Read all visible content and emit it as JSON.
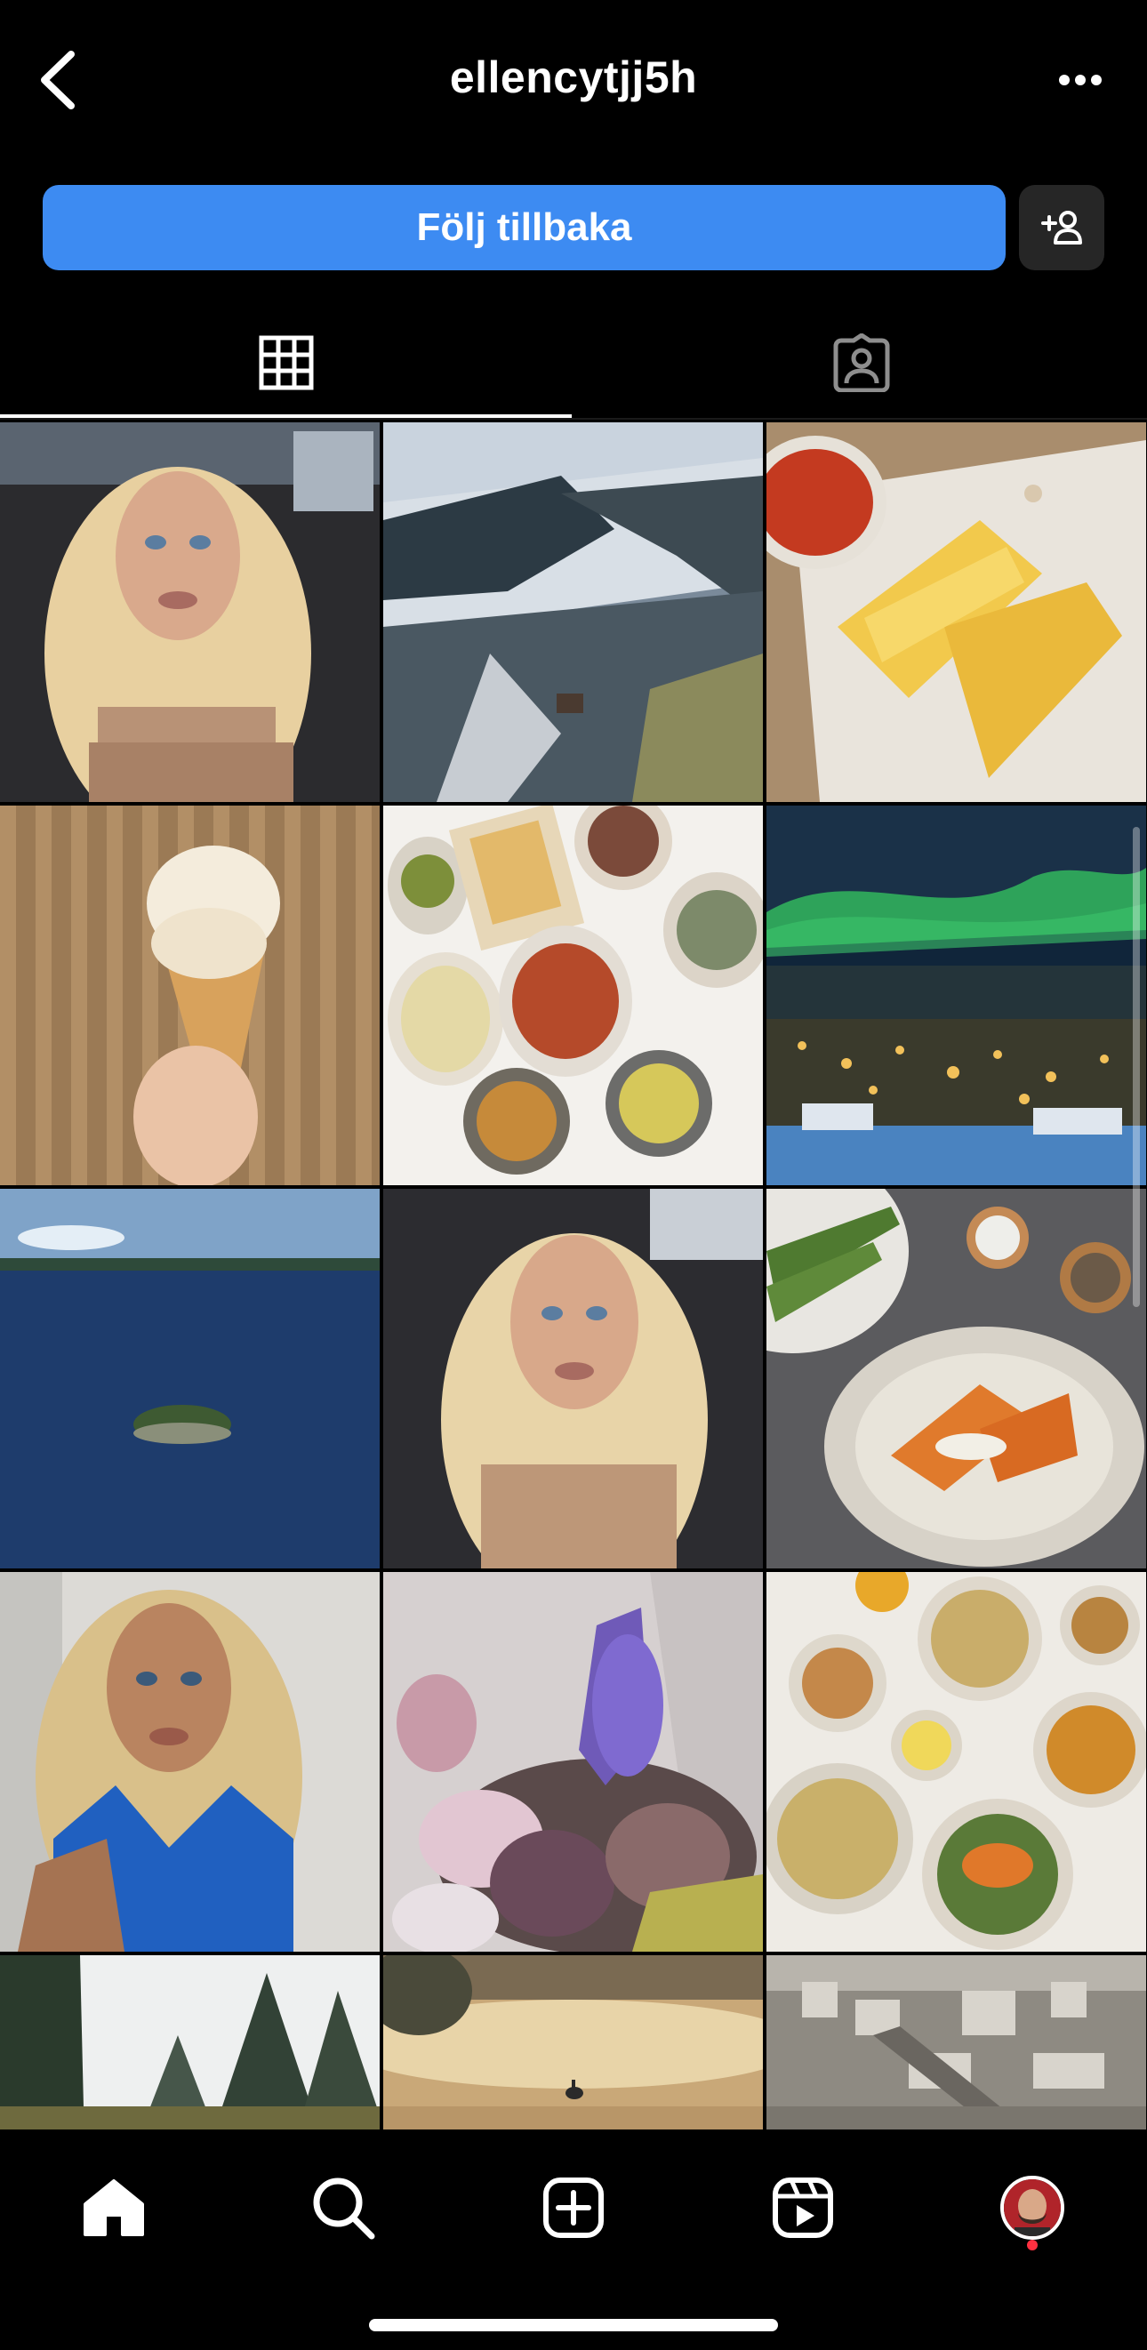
{
  "header": {
    "username": "ellencytjj5h",
    "back_icon": "chevron-left-icon",
    "more_icon": "more-horizontal-icon"
  },
  "actions": {
    "follow_label": "Följ tillbaka",
    "follow_color": "#3d8bf2",
    "suggest_icon": "add-person-icon"
  },
  "tabs": [
    {
      "name": "posts-grid",
      "icon": "grid-icon",
      "selected": true
    },
    {
      "name": "tagged",
      "icon": "tagged-person-icon",
      "selected": false
    }
  ],
  "grid": {
    "posts": [
      {
        "subject": "blonde woman selfie in car"
      },
      {
        "subject": "snowy forest aerial with river"
      },
      {
        "subject": "fresh pasta in box with tomato sauce"
      },
      {
        "subject": "ice cream cone"
      },
      {
        "subject": "table spread of dishes"
      },
      {
        "subject": "northern lights over town"
      },
      {
        "subject": "small island in blue lake"
      },
      {
        "subject": "blonde woman selfie in car"
      },
      {
        "subject": "roasted pumpkin dish with green beans"
      },
      {
        "subject": "blonde woman in blue top"
      },
      {
        "subject": "flower bouquet with delphinium"
      },
      {
        "subject": "table of food bowls"
      },
      {
        "subject": "snowy pine trees"
      },
      {
        "subject": "misty lake with seagull"
      },
      {
        "subject": "aerial city view"
      }
    ]
  },
  "bottom_nav": {
    "items": [
      {
        "name": "home",
        "icon": "home-icon",
        "active": true
      },
      {
        "name": "search",
        "icon": "search-icon",
        "active": false
      },
      {
        "name": "create",
        "icon": "plus-square-icon",
        "active": false
      },
      {
        "name": "reels",
        "icon": "reels-icon",
        "active": false
      },
      {
        "name": "profile",
        "icon": "avatar-icon",
        "active": false
      }
    ],
    "notification_dot_color": "#ff3040"
  }
}
